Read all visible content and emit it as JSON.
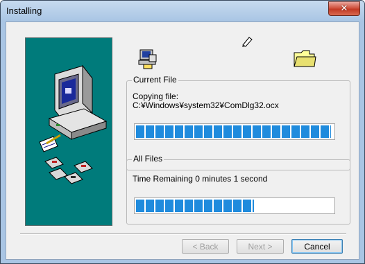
{
  "window": {
    "title": "Installing"
  },
  "icons": {
    "close": "close-icon",
    "setup": "setup-computer-icon",
    "pen": "pen-icon",
    "folder": "folder-icon",
    "illustration": "computer-install-illustration"
  },
  "current_file": {
    "legend": "Current File",
    "line1": "Copying file:",
    "line2": "C:¥Windows¥system32¥ComDlg32.ocx",
    "progress": 0.99
  },
  "all_files": {
    "legend": "All Files",
    "time_remaining": "Time Remaining 0 minutes 1 second",
    "progress": 0.6
  },
  "buttons": {
    "back": "< Back",
    "next": "Next >",
    "cancel": "Cancel"
  },
  "colors": {
    "progress_fill": "#1f8bdd",
    "panel_bg": "#007b7b"
  }
}
